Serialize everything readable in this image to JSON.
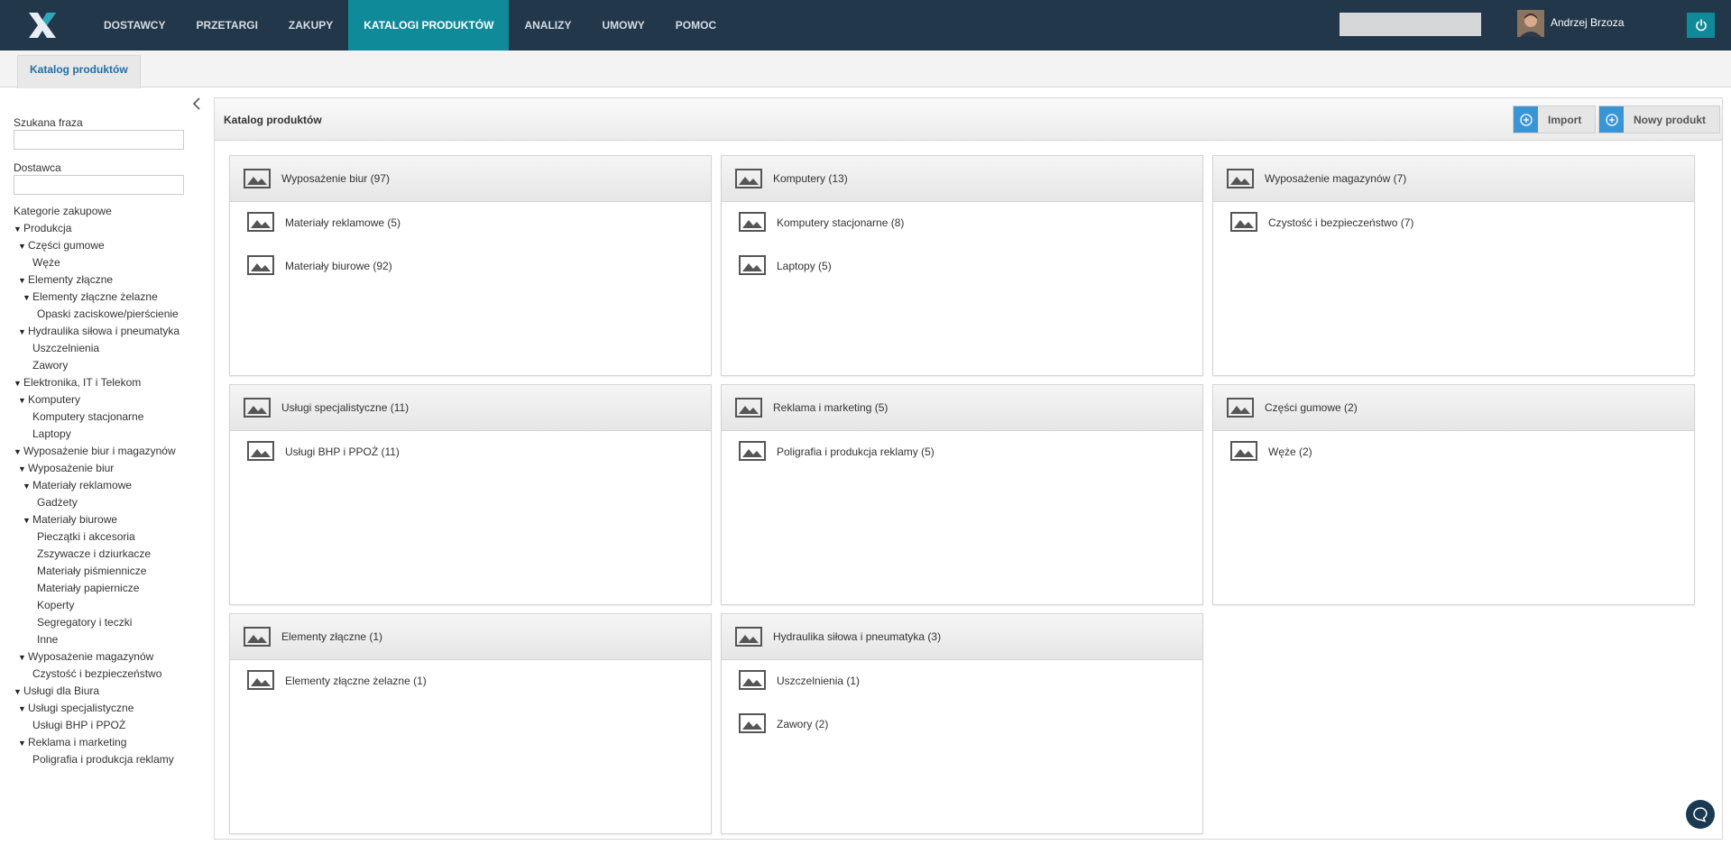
{
  "nav": {
    "items": [
      "DOSTAWCY",
      "PRZETARGI",
      "ZAKUPY",
      "KATALOGI PRODUKTÓW",
      "ANALIZY",
      "UMOWY",
      "POMOC"
    ],
    "active_index": 3,
    "search_value": "",
    "user_name": "Andrzej Brzoza",
    "colors": {
      "bar": "#22374a",
      "accent": "#0f8a99"
    }
  },
  "tabbar": {
    "active_tab": "Katalog produktów"
  },
  "sidebar": {
    "search_label": "Szukana fraza",
    "search_value": "",
    "supplier_label": "Dostawca",
    "supplier_value": "",
    "categories_label": "Kategorie zakupowe",
    "tree": [
      {
        "label": "Produkcja",
        "level": 0,
        "expanded": true
      },
      {
        "label": "Części gumowe",
        "level": 1,
        "expanded": true
      },
      {
        "label": "Węże",
        "level": 2,
        "expanded": false
      },
      {
        "label": "Elementy złączne",
        "level": 1,
        "expanded": true
      },
      {
        "label": "Elementy złączne żelazne",
        "level": 2,
        "expanded": true
      },
      {
        "label": "Opaski zaciskowe/pierścienie",
        "level": 3,
        "expanded": false
      },
      {
        "label": "Hydraulika siłowa i pneumatyka",
        "level": 1,
        "expanded": true
      },
      {
        "label": "Uszczelnienia",
        "level": 2,
        "expanded": false
      },
      {
        "label": "Zawory",
        "level": 2,
        "expanded": false
      },
      {
        "label": "Elektronika, IT i Telekom",
        "level": 0,
        "expanded": true
      },
      {
        "label": "Komputery",
        "level": 1,
        "expanded": true
      },
      {
        "label": "Komputery stacjonarne",
        "level": 2,
        "expanded": false
      },
      {
        "label": "Laptopy",
        "level": 2,
        "expanded": false
      },
      {
        "label": "Wyposażenie biur i magazynów",
        "level": 0,
        "expanded": true
      },
      {
        "label": "Wyposażenie biur",
        "level": 1,
        "expanded": true
      },
      {
        "label": "Materiały reklamowe",
        "level": 2,
        "expanded": true
      },
      {
        "label": "Gadżety",
        "level": 3,
        "expanded": false
      },
      {
        "label": "Materiały biurowe",
        "level": 2,
        "expanded": true
      },
      {
        "label": "Pieczątki i akcesoria",
        "level": 3,
        "expanded": false
      },
      {
        "label": "Zszywacze i dziurkacze",
        "level": 3,
        "expanded": false
      },
      {
        "label": "Materiały piśmiennicze",
        "level": 3,
        "expanded": false
      },
      {
        "label": "Materiały papiernicze",
        "level": 3,
        "expanded": false
      },
      {
        "label": "Koperty",
        "level": 3,
        "expanded": false
      },
      {
        "label": "Segregatory i teczki",
        "level": 3,
        "expanded": false
      },
      {
        "label": "Inne",
        "level": 3,
        "expanded": false
      },
      {
        "label": "Wyposażenie magazynów",
        "level": 1,
        "expanded": true
      },
      {
        "label": "Czystość i bezpieczeństwo",
        "level": 2,
        "expanded": false
      },
      {
        "label": "Usługi dla Biura",
        "level": 0,
        "expanded": true
      },
      {
        "label": "Usługi specjalistyczne",
        "level": 1,
        "expanded": true
      },
      {
        "label": "Usługi BHP i PPOŻ",
        "level": 2,
        "expanded": false
      },
      {
        "label": "Reklama i marketing",
        "level": 1,
        "expanded": true
      },
      {
        "label": "Poligrafia i produkcja reklamy",
        "level": 2,
        "expanded": false
      }
    ]
  },
  "main": {
    "title": "Katalog produktów",
    "import_label": "Import",
    "new_product_label": "Nowy produkt",
    "cards": [
      {
        "title": "Wyposażenie biur (97)",
        "items": [
          "Materiały reklamowe (5)",
          "Materiały biurowe (92)"
        ]
      },
      {
        "title": "Komputery (13)",
        "items": [
          "Komputery stacjonarne (8)",
          "Laptopy (5)"
        ]
      },
      {
        "title": "Wyposażenie magazynów (7)",
        "items": [
          "Czystość i bezpieczeństwo (7)"
        ]
      },
      {
        "title": "Usługi specjalistyczne (11)",
        "items": [
          "Usługi BHP i PPOŻ (11)"
        ]
      },
      {
        "title": "Reklama i marketing (5)",
        "items": [
          "Poligrafia i produkcja reklamy (5)"
        ]
      },
      {
        "title": "Części gumowe (2)",
        "items": [
          "Węże (2)"
        ]
      },
      {
        "title": "Elementy złączne (1)",
        "items": [
          "Elementy złączne żelazne (1)"
        ]
      },
      {
        "title": "Hydraulika siłowa i pneumatyka (3)",
        "items": [
          "Uszczelnienia (1)",
          "Zawory (2)"
        ]
      }
    ]
  }
}
